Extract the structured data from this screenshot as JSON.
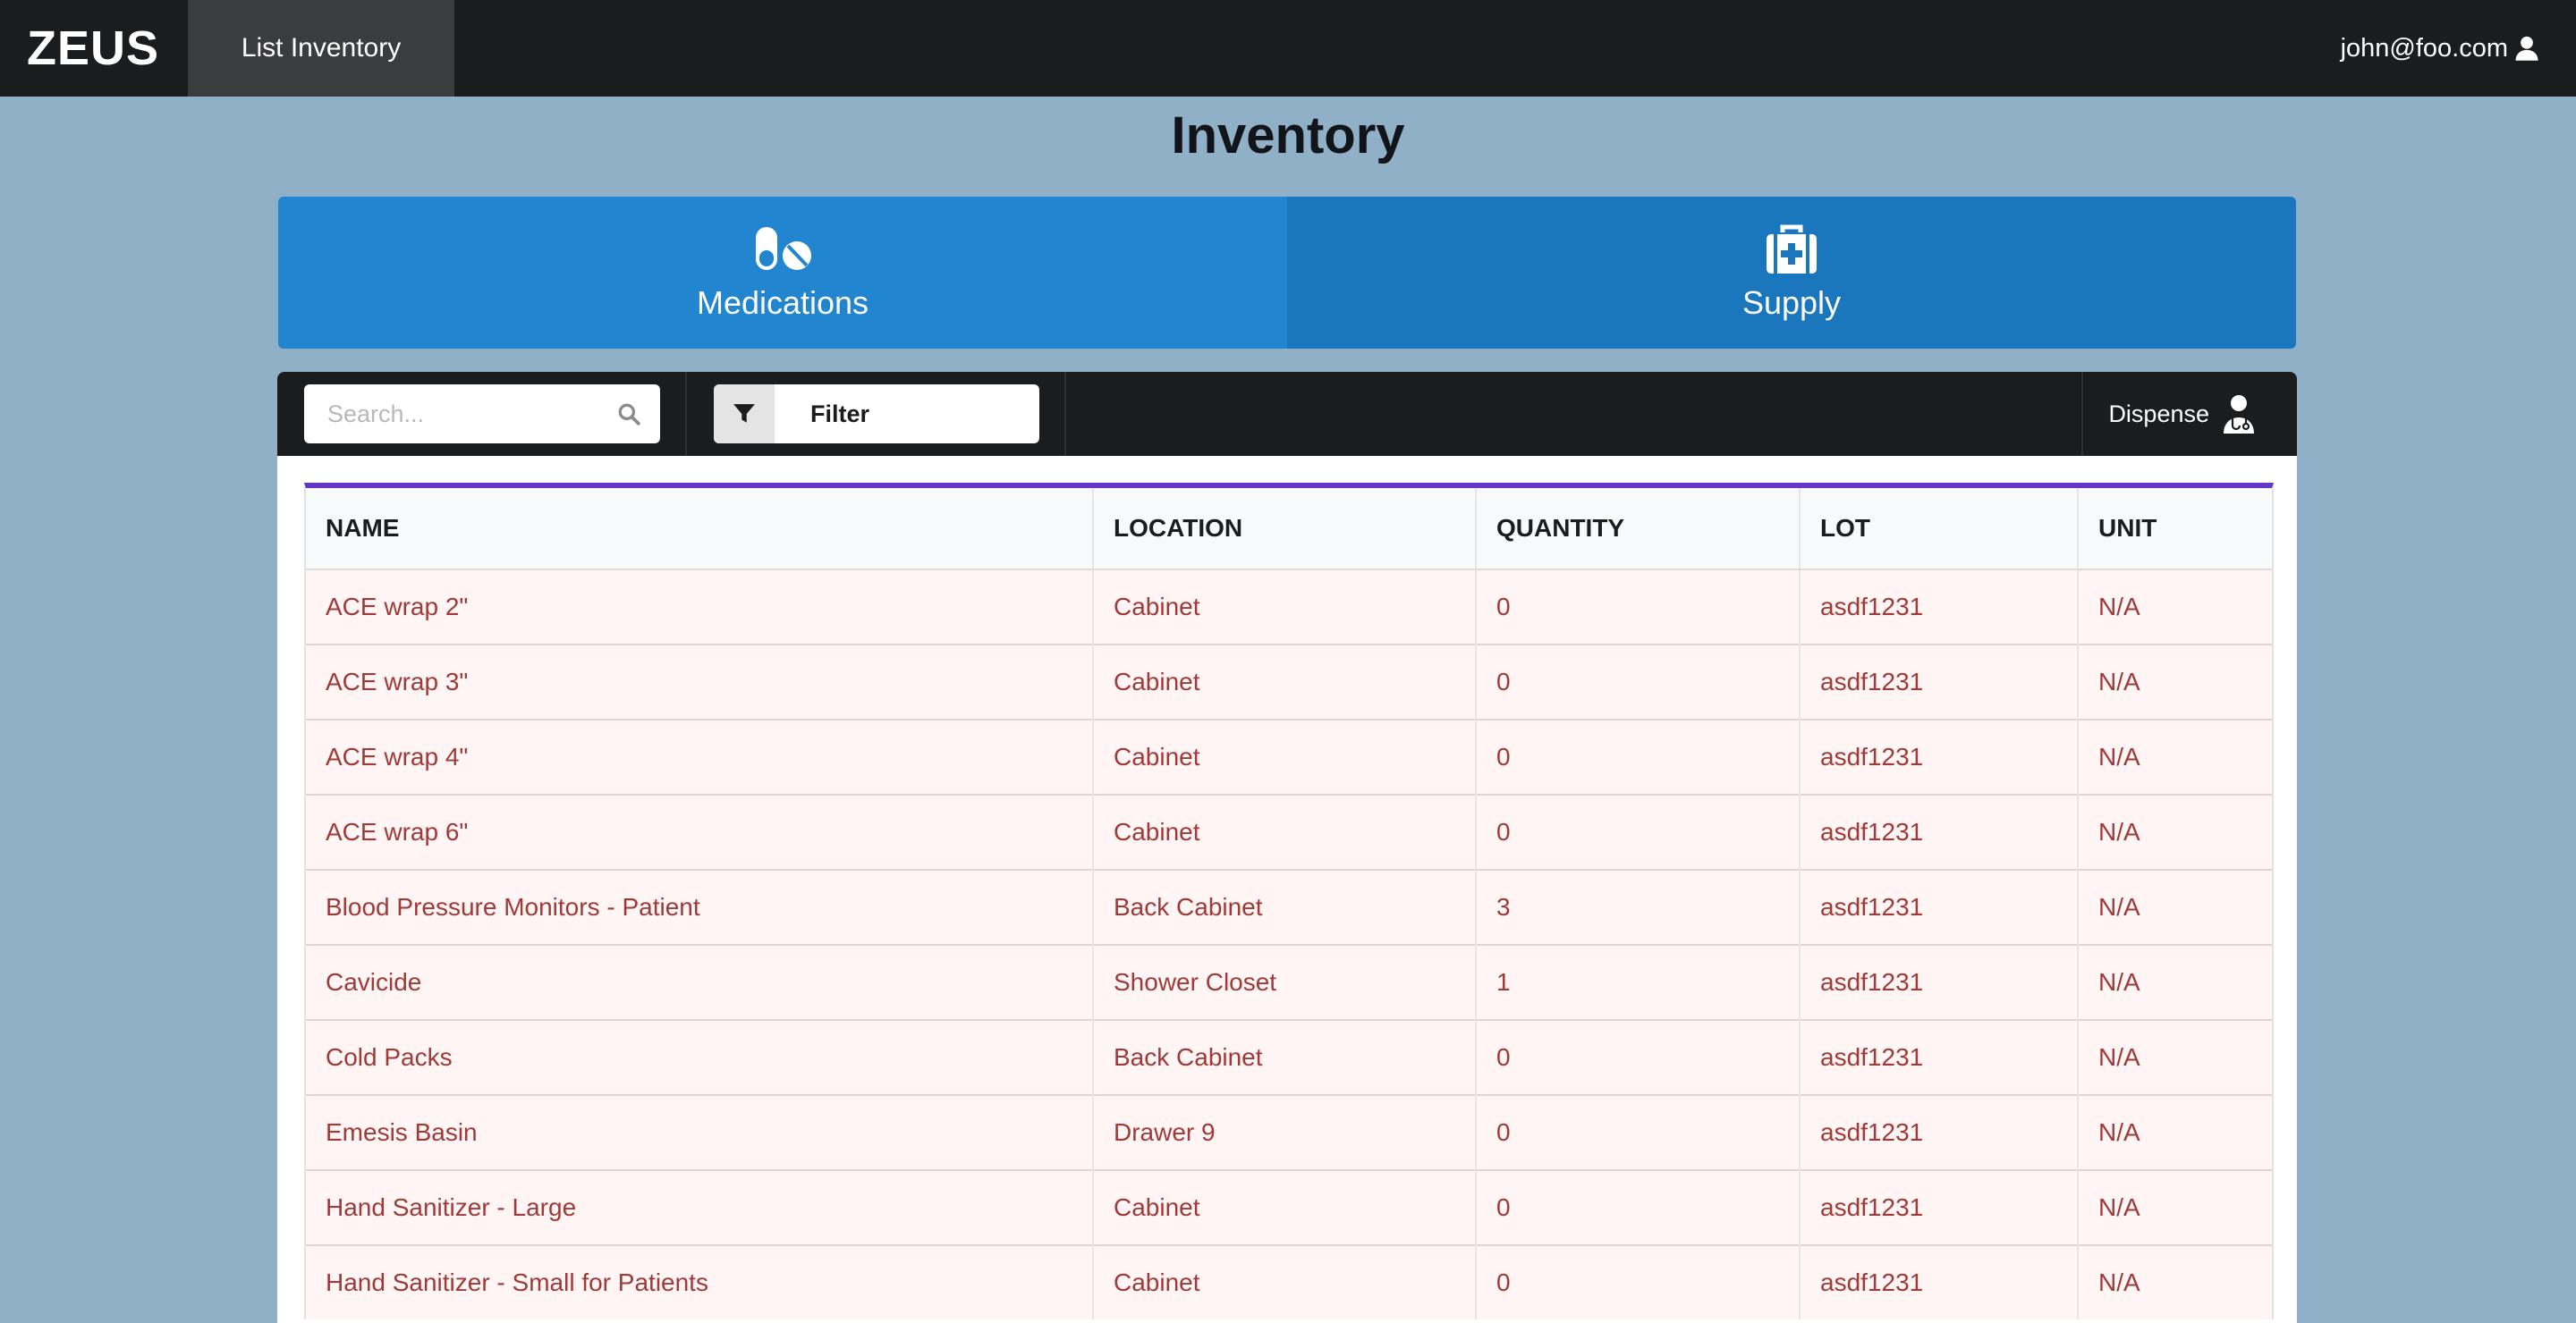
{
  "navbar": {
    "brand": "ZEUS",
    "tab_label": "List Inventory",
    "user_email": "john@foo.com"
  },
  "page": {
    "title": "Inventory"
  },
  "categories": [
    {
      "label": "Medications",
      "icon": "pills-icon"
    },
    {
      "label": "Supply",
      "icon": "medical-kit-icon"
    }
  ],
  "toolbar": {
    "search_placeholder": "Search...",
    "filter_label": "Filter",
    "dispense_label": "Dispense"
  },
  "table": {
    "columns": [
      "NAME",
      "LOCATION",
      "QUANTITY",
      "LOT",
      "UNIT"
    ],
    "rows": [
      [
        "ACE wrap 2\"",
        "Cabinet",
        "0",
        "asdf1231",
        "N/A"
      ],
      [
        "ACE wrap 3\"",
        "Cabinet",
        "0",
        "asdf1231",
        "N/A"
      ],
      [
        "ACE wrap 4\"",
        "Cabinet",
        "0",
        "asdf1231",
        "N/A"
      ],
      [
        "ACE wrap 6\"",
        "Cabinet",
        "0",
        "asdf1231",
        "N/A"
      ],
      [
        "Blood Pressure Monitors - Patient",
        "Back Cabinet",
        "3",
        "asdf1231",
        "N/A"
      ],
      [
        "Cavicide",
        "Shower Closet",
        "1",
        "asdf1231",
        "N/A"
      ],
      [
        "Cold Packs",
        "Back Cabinet",
        "0",
        "asdf1231",
        "N/A"
      ],
      [
        "Emesis Basin",
        "Drawer 9",
        "0",
        "asdf1231",
        "N/A"
      ],
      [
        "Hand Sanitizer - Large",
        "Cabinet",
        "0",
        "asdf1231",
        "N/A"
      ],
      [
        "Hand Sanitizer - Small for Patients",
        "Cabinet",
        "0",
        "asdf1231",
        "N/A"
      ]
    ]
  },
  "colors": {
    "page_bg": "#8fb0c7",
    "navbar_bg": "#1b1c1e",
    "medications_bg": "#2185d0",
    "supply_bg": "#1a76bd",
    "table_accent": "#6435c9",
    "row_bg": "#fff5f4",
    "row_text": "#9f3a38"
  }
}
